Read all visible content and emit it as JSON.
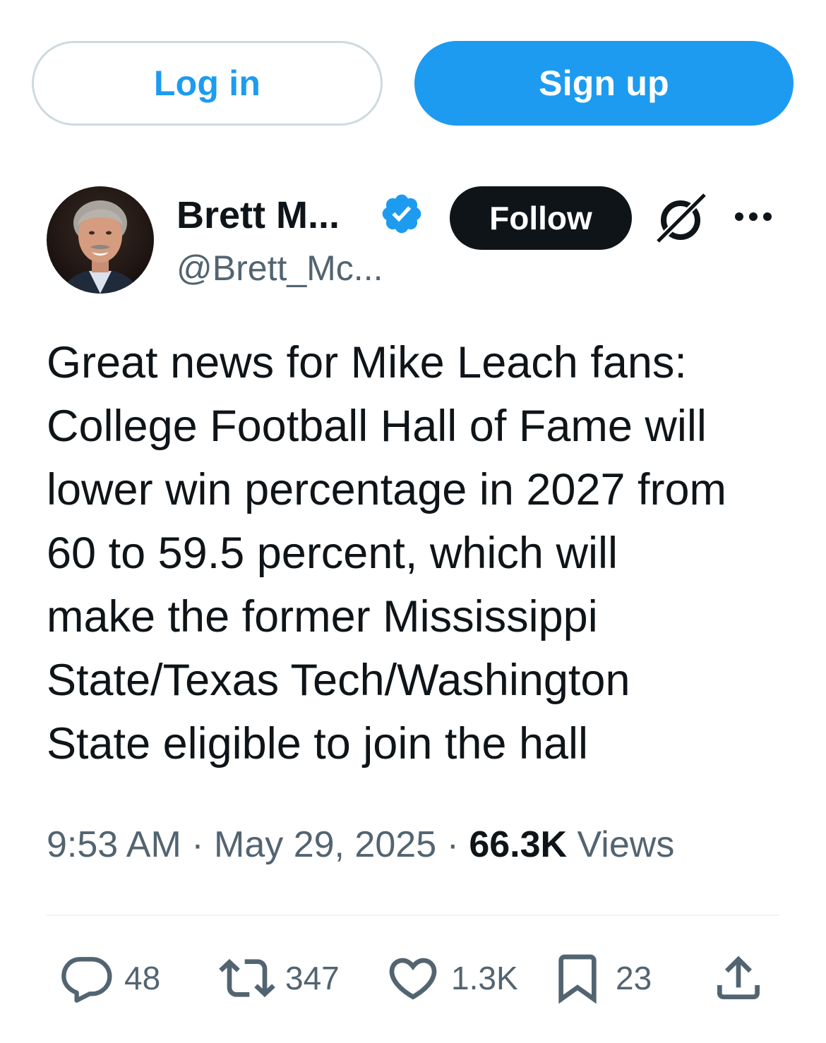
{
  "auth": {
    "login_label": "Log in",
    "signup_label": "Sign up"
  },
  "colors": {
    "accent": "#1d9bf0",
    "text_primary": "#0f1419",
    "text_secondary": "#536471",
    "border": "#cfd9de"
  },
  "author": {
    "display_name": "Brett M...",
    "handle": "@Brett_Mc...",
    "verified_icon": "verified-badge-icon",
    "follow_label": "Follow",
    "grok_icon": "grok-icon",
    "more_icon": "more-options-icon"
  },
  "tweet": {
    "text": "Great news for Mike Leach fans:\nCollege Football Hall of Fame will\nlower win percentage in 2027 from\n60 to 59.5 percent, which will\nmake the former Mississippi\nState/Texas Tech/Washington\nState eligible to join the hall",
    "time": "9:53 AM",
    "separator": " · ",
    "date": "May 29, 2025",
    "views_count": "66.3K",
    "views_label": " Views"
  },
  "actions": {
    "replies": "48",
    "reposts": "347",
    "likes": "1.3K",
    "bookmarks": "23"
  }
}
